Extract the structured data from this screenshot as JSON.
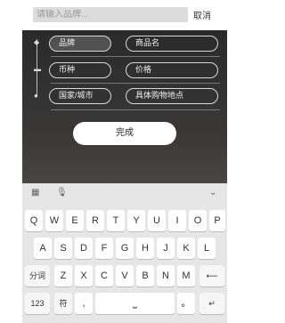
{
  "search": {
    "placeholder": "请输入品牌...",
    "cancel_label": "取消"
  },
  "filters": {
    "row1": [
      "品牌",
      "商品名"
    ],
    "row2": [
      "币种",
      "价格"
    ],
    "row3": [
      "国家/城市",
      "具体购物地点"
    ],
    "done_label": "完成"
  },
  "keyboard": {
    "row1": [
      "Q",
      "W",
      "E",
      "R",
      "T",
      "Y",
      "U",
      "I",
      "O",
      "P"
    ],
    "row2": [
      "A",
      "S",
      "D",
      "F",
      "G",
      "H",
      "J",
      "K",
      "L"
    ],
    "row3": [
      "Z",
      "X",
      "C",
      "V",
      "B",
      "N",
      "M"
    ],
    "fenci_label": "分词",
    "numbers_label": "123",
    "symbol_label": "符",
    "comma_label": ",",
    "period_label": "。"
  },
  "icons": [
    "grid-icon",
    "microphone-icon",
    "chevron-down-icon",
    "tag-icon",
    "currency-icon",
    "location-pin-icon",
    "backspace-icon",
    "return-icon",
    "space-icon"
  ]
}
